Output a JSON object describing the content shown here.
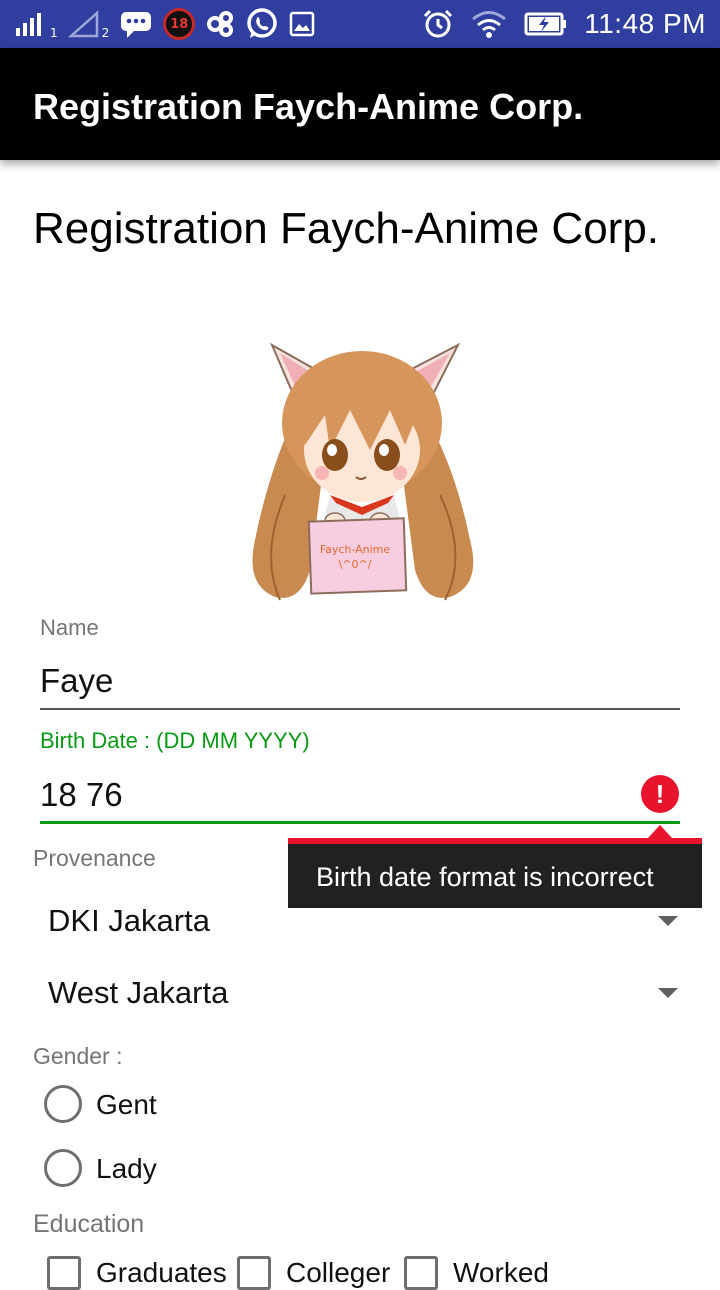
{
  "status_bar": {
    "time": "11:48 PM",
    "sim1": "1",
    "sim2": "2",
    "notification_badge": "18",
    "icons": [
      "signal-icon",
      "signal-icon",
      "chat-icon",
      "badge-icon",
      "infinity-icon",
      "whatsapp-icon",
      "image-icon",
      "alarm-icon",
      "wifi-icon",
      "battery-icon"
    ]
  },
  "app_bar": {
    "title": "Registration Faych-Anime Corp."
  },
  "page": {
    "title": "Registration Faych-Anime Corp."
  },
  "mascot": {
    "sign_line1": "Faych-Anime",
    "sign_line2": "\\^0^/"
  },
  "form": {
    "name": {
      "label": "Name",
      "value": "Faye"
    },
    "birth_date": {
      "label": "Birth Date : (DD MM YYYY)",
      "value": "18 76",
      "error_icon": "!",
      "error": "Birth date format is incorrect"
    },
    "provenance": {
      "label": "Provenance",
      "province": "DKI Jakarta",
      "city": "West Jakarta"
    },
    "gender": {
      "label": "Gender :",
      "options": [
        "Gent",
        "Lady"
      ]
    },
    "education": {
      "label": "Education",
      "options": [
        "Graduates",
        "Colleger",
        "Worked"
      ]
    }
  },
  "colors": {
    "status_bar": "#303f9f",
    "app_bar": "#000000",
    "accent_green": "#0a9a14",
    "error_red": "#e8132d"
  }
}
